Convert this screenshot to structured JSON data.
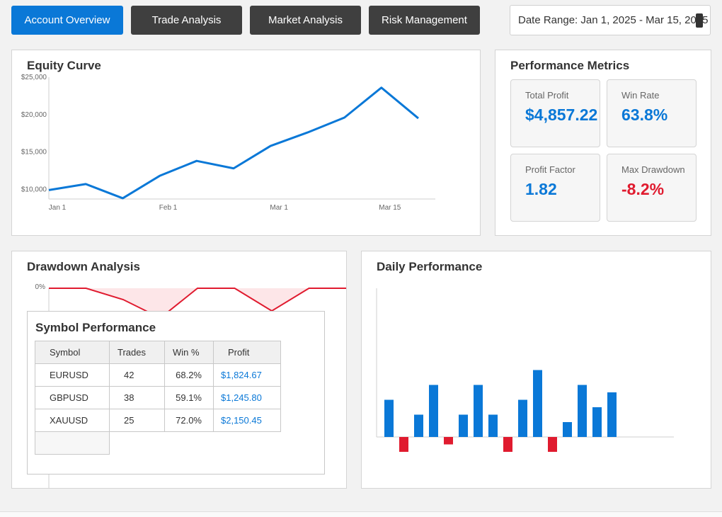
{
  "tabs": [
    {
      "label": "Account Overview",
      "active": true
    },
    {
      "label": "Trade Analysis",
      "active": false
    },
    {
      "label": "Market Analysis",
      "active": false
    },
    {
      "label": "Risk Management",
      "active": false
    }
  ],
  "date_range": {
    "value": "Date Range: Jan 1, 2025 - Mar 15, 2025"
  },
  "equity_curve": {
    "title": "Equity Curve",
    "chart_data": {
      "type": "line",
      "y_tick_labels": [
        "$25,000",
        "$20,000",
        "$15,000",
        "$10,000"
      ],
      "x_tick_labels": [
        "Jan 1",
        "Feb 1",
        "Mar 1",
        "Mar 15"
      ],
      "ylim": [
        8700,
        25000
      ],
      "color": "#0a78d7",
      "values": [
        9900,
        10700,
        8800,
        11800,
        13800,
        12800,
        15800,
        17600,
        19600,
        23600,
        19500
      ]
    }
  },
  "performance_metrics": {
    "title": "Performance Metrics",
    "cards": [
      {
        "label": "Total Profit",
        "value": "$4,857.22",
        "negative": false
      },
      {
        "label": "Win Rate",
        "value": "63.8%",
        "negative": false
      },
      {
        "label": "Profit Factor",
        "value": "1.82",
        "negative": false
      },
      {
        "label": "Max Drawdown",
        "value": "-8.2%",
        "negative": true
      }
    ]
  },
  "drawdown": {
    "title": "Drawdown Analysis",
    "chart_data": {
      "type": "area",
      "y_tick_labels": [
        "0%"
      ],
      "color": "#e01b2f",
      "values": [
        0,
        0,
        -1.6,
        -4.2,
        0,
        0,
        -3.2,
        0,
        0
      ]
    }
  },
  "symbol_performance": {
    "title": "Symbol Performance",
    "headers": [
      "Symbol",
      "Trades",
      "Win %",
      "Profit"
    ],
    "rows": [
      {
        "symbol": "EURUSD",
        "trades": "42",
        "win": "68.2%",
        "profit": "$1,824.67"
      },
      {
        "symbol": "GBPUSD",
        "trades": "38",
        "win": "59.1%",
        "profit": "$1,245.80"
      },
      {
        "symbol": "XAUUSD",
        "trades": "25",
        "win": "72.0%",
        "profit": "$2,150.45"
      }
    ]
  },
  "daily_performance": {
    "title": "Daily Performance",
    "chart_data": {
      "type": "bar",
      "positive_color": "#0a78d7",
      "negative_color": "#e01b2f",
      "values": [
        5,
        -2,
        3,
        7,
        -1,
        3,
        7,
        3,
        -2,
        5,
        9,
        -2,
        2,
        7,
        4,
        6
      ]
    }
  }
}
